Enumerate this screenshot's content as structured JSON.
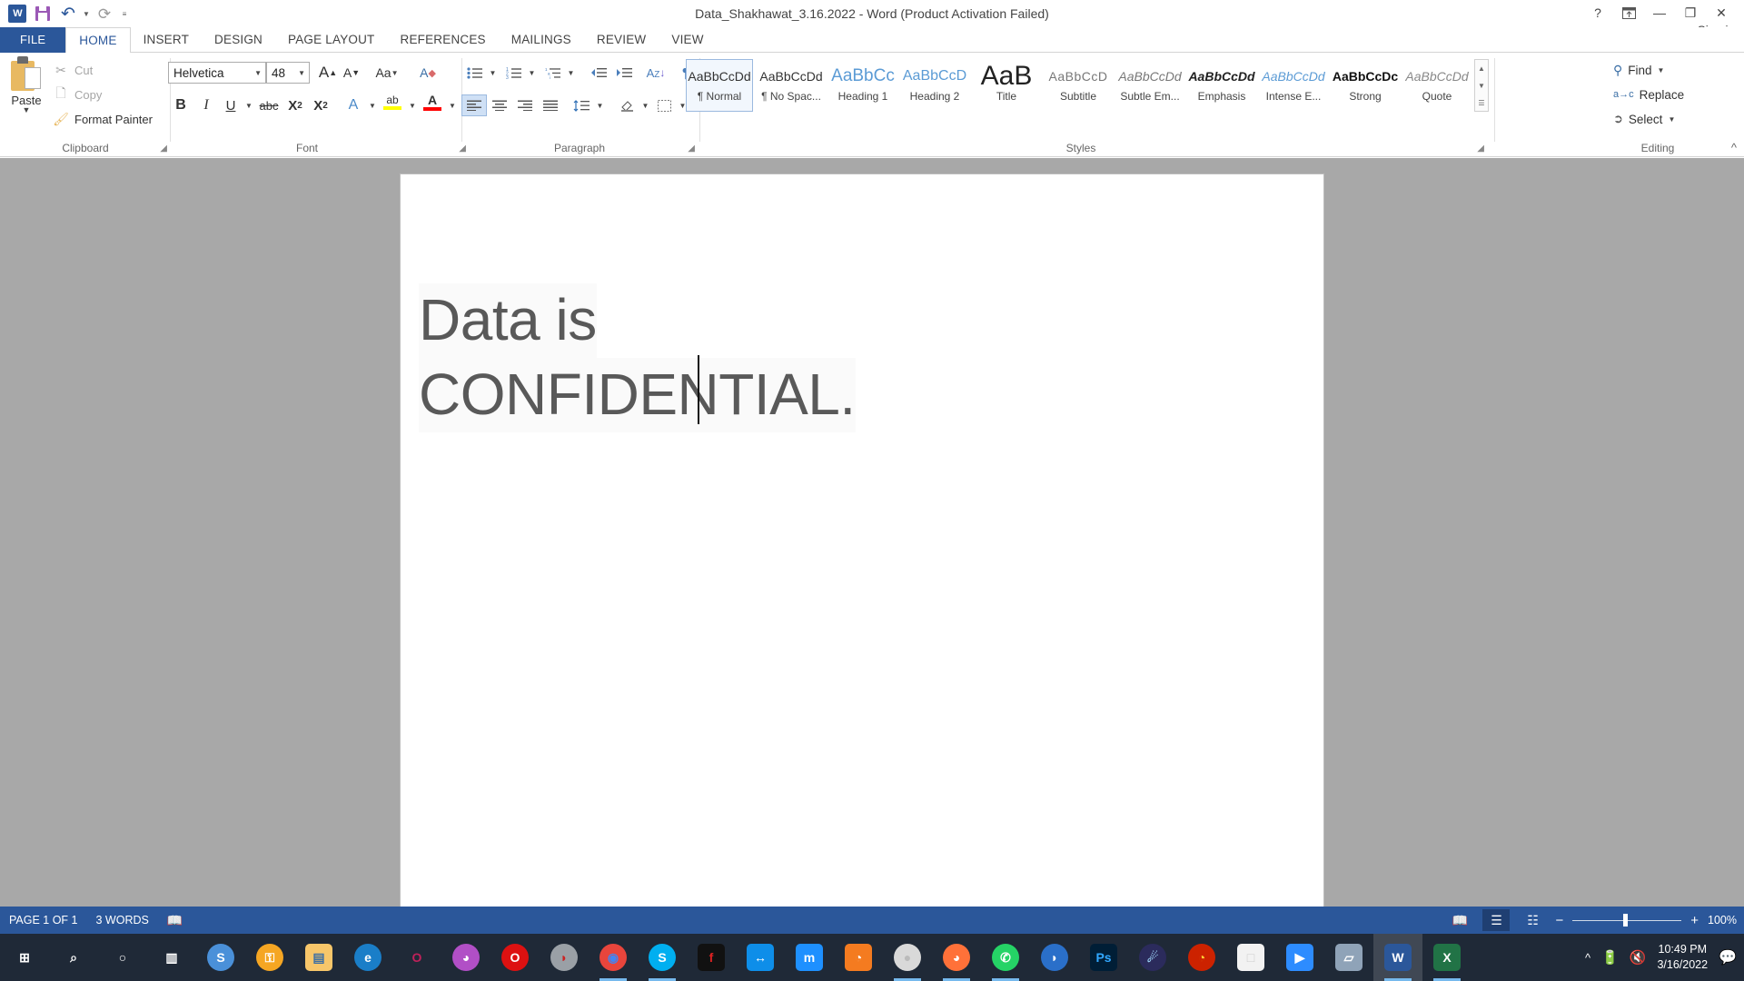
{
  "window": {
    "title": "Data_Shakhawat_3.16.2022 - Word (Product Activation Failed)",
    "signin": "Sign in",
    "help_icon": "?",
    "ribbon_display_icon": "ribbon-display-options-icon",
    "minimize_icon": "—",
    "restore_icon": "❐",
    "close_icon": "✕"
  },
  "quick_access": {
    "word_logo": "W",
    "save_label": "save-icon",
    "undo_label": "undo-icon",
    "redo_label": "redo-icon",
    "customize_label": "customize-quick-access-toolbar"
  },
  "tabs": [
    {
      "label": "FILE",
      "active": false,
      "file": true
    },
    {
      "label": "HOME",
      "active": true,
      "file": false
    },
    {
      "label": "INSERT",
      "active": false,
      "file": false
    },
    {
      "label": "DESIGN",
      "active": false,
      "file": false
    },
    {
      "label": "PAGE LAYOUT",
      "active": false,
      "file": false
    },
    {
      "label": "REFERENCES",
      "active": false,
      "file": false
    },
    {
      "label": "MAILINGS",
      "active": false,
      "file": false
    },
    {
      "label": "REVIEW",
      "active": false,
      "file": false
    },
    {
      "label": "VIEW",
      "active": false,
      "file": false
    }
  ],
  "clipboard": {
    "group_label": "Clipboard",
    "paste": "Paste",
    "cut": "Cut",
    "copy": "Copy",
    "format_painter": "Format Painter"
  },
  "font": {
    "group_label": "Font",
    "font_name": "Helvetica",
    "font_size": "48",
    "grow_font": "A",
    "shrink_font": "A",
    "change_case": "Aa",
    "clear_formatting": "A",
    "bold": "B",
    "italic": "I",
    "underline": "U",
    "strikethrough": "abc",
    "subscript": "X",
    "superscript": "X",
    "text_effects": "A",
    "highlight": "ab",
    "font_color": "A",
    "highlight_color": "#ffff00",
    "font_color_value": "#ff0000"
  },
  "paragraph": {
    "group_label": "Paragraph",
    "bullets": "bullets-icon",
    "numbering": "numbering-icon",
    "multilevel": "multilevel-list-icon",
    "decrease_indent": "◄≡",
    "increase_indent": "≡►",
    "sort": "sort-icon",
    "show_marks": "¶",
    "align_left": "align-left-icon",
    "align_center": "align-center-icon",
    "align_right": "align-right-icon",
    "justify": "justify-icon",
    "line_spacing": "line-spacing-icon",
    "shading": "shading-icon",
    "borders": "borders-icon"
  },
  "styles": {
    "group_label": "Styles",
    "items": [
      {
        "sample": "AaBbCcDd",
        "name": "¶ Normal",
        "selected": true,
        "style": "plain"
      },
      {
        "sample": "AaBbCcDd",
        "name": "¶ No Spac...",
        "selected": false,
        "style": "plain"
      },
      {
        "sample": "AaBbCc",
        "name": "Heading 1",
        "selected": false,
        "style": "heading1"
      },
      {
        "sample": "AaBbCcD",
        "name": "Heading 2",
        "selected": false,
        "style": "heading2"
      },
      {
        "sample": "AaB",
        "name": "Title",
        "selected": false,
        "style": "title"
      },
      {
        "sample": "AaBbCcD",
        "name": "Subtitle",
        "selected": false,
        "style": "subtitle"
      },
      {
        "sample": "AaBbCcDd",
        "name": "Subtle Em...",
        "selected": false,
        "style": "italic"
      },
      {
        "sample": "AaBbCcDd",
        "name": "Emphasis",
        "selected": false,
        "style": "bolditalic"
      },
      {
        "sample": "AaBbCcDd",
        "name": "Intense E...",
        "selected": false,
        "style": "blueitalic"
      },
      {
        "sample": "AaBbCcDc",
        "name": "Strong",
        "selected": false,
        "style": "bold"
      },
      {
        "sample": "AaBbCcDd",
        "name": "Quote",
        "selected": false,
        "style": "italicgray"
      }
    ],
    "scroll_up": "▲",
    "scroll_down": "▼",
    "scroll_more": "▤"
  },
  "editing": {
    "group_label": "Editing",
    "find": "Find",
    "replace": "Replace",
    "select": "Select",
    "collapse_ribbon": "^"
  },
  "document": {
    "line1": "Data is",
    "line2_before_caret": "CONFID",
    "line2_after_caret": "ENTIAL."
  },
  "status": {
    "page": "PAGE 1 OF 1",
    "words": "3 WORDS",
    "proofing_icon": "proofing-errors-icon",
    "read_mode_icon": "read-mode-icon",
    "print_layout_icon": "print-layout-icon",
    "web_layout_icon": "web-layout-icon",
    "zoom_out": "−",
    "zoom_in": "+",
    "zoom_level": "100%"
  },
  "taskbar": {
    "items": [
      {
        "name": "start-button",
        "glyph": "⊞",
        "bg": "transparent",
        "color": "#ffffff",
        "running": false,
        "active": false,
        "shape": "square"
      },
      {
        "name": "search-button",
        "glyph": "⌕",
        "bg": "transparent",
        "color": "#ffffff",
        "running": false,
        "active": false,
        "shape": "square"
      },
      {
        "name": "cortana-button",
        "glyph": "○",
        "bg": "transparent",
        "color": "#ffffff",
        "running": false,
        "active": false,
        "shape": "square"
      },
      {
        "name": "task-view-button",
        "glyph": "▥",
        "bg": "transparent",
        "color": "#ffffff",
        "running": false,
        "active": false,
        "shape": "square"
      },
      {
        "name": "internet-app-icon",
        "glyph": "S",
        "bg": "#4a90d9",
        "color": "#ffffff",
        "running": false,
        "active": false,
        "shape": "circle"
      },
      {
        "name": "avast-secure-browser-icon",
        "glyph": "⚿",
        "bg": "#f5a623",
        "color": "#ffffff",
        "running": false,
        "active": false,
        "shape": "circle"
      },
      {
        "name": "file-explorer-icon",
        "glyph": "▤",
        "bg": "#f7c66a",
        "color": "#3b6ea5",
        "running": false,
        "active": false,
        "shape": "square"
      },
      {
        "name": "microsoft-edge-icon",
        "glyph": "e",
        "bg": "#1a7ec8",
        "color": "#ffffff",
        "running": false,
        "active": false,
        "shape": "circle"
      },
      {
        "name": "opera-neon-icon",
        "glyph": "O",
        "bg": "transparent",
        "color": "#c0215a",
        "running": false,
        "active": false,
        "shape": "circle"
      },
      {
        "name": "opera-gx-icon",
        "glyph": "◕",
        "bg": "#b14fc6",
        "color": "#ffffff",
        "running": false,
        "active": false,
        "shape": "circle"
      },
      {
        "name": "opera-browser-icon",
        "glyph": "O",
        "bg": "#dd1111",
        "color": "#ffffff",
        "running": false,
        "active": false,
        "shape": "circle"
      },
      {
        "name": "avast-antivirus-icon",
        "glyph": "◗",
        "bg": "#9aa0a6",
        "color": "#cc2222",
        "running": false,
        "active": false,
        "shape": "circle"
      },
      {
        "name": "google-chrome-icon",
        "glyph": "◉",
        "bg": "#e8453c",
        "color": "#4285f4",
        "running": true,
        "active": false,
        "shape": "circle"
      },
      {
        "name": "skype-icon",
        "glyph": "S",
        "bg": "#00aff0",
        "color": "#ffffff",
        "running": true,
        "active": false,
        "shape": "circle"
      },
      {
        "name": "flash-player-icon",
        "glyph": "f",
        "bg": "#111111",
        "color": "#dd2222",
        "running": false,
        "active": false,
        "shape": "square"
      },
      {
        "name": "teamviewer-icon",
        "glyph": "↔",
        "bg": "#0e8ee9",
        "color": "#ffffff",
        "running": false,
        "active": false,
        "shape": "square"
      },
      {
        "name": "maxthon-icon",
        "glyph": "m",
        "bg": "#1e90ff",
        "color": "#ffffff",
        "running": false,
        "active": false,
        "shape": "square"
      },
      {
        "name": "uc-browser-icon",
        "glyph": "◔",
        "bg": "#f47b20",
        "color": "#ffffff",
        "running": false,
        "active": false,
        "shape": "square"
      },
      {
        "name": "sphere-app-icon",
        "glyph": "●",
        "bg": "#d9d9d9",
        "color": "#bbbbbb",
        "running": true,
        "active": false,
        "shape": "circle"
      },
      {
        "name": "mozilla-firefox-icon",
        "glyph": "◕",
        "bg": "#ff7139",
        "color": "#ffffff",
        "running": true,
        "active": false,
        "shape": "circle"
      },
      {
        "name": "whatsapp-icon",
        "glyph": "✆",
        "bg": "#25d366",
        "color": "#ffffff",
        "running": true,
        "active": false,
        "shape": "circle"
      },
      {
        "name": "blue-browser-icon",
        "glyph": "◗",
        "bg": "#2a6fc9",
        "color": "#ffffff",
        "running": false,
        "active": false,
        "shape": "circle"
      },
      {
        "name": "adobe-photoshop-icon",
        "glyph": "Ps",
        "bg": "#001e36",
        "color": "#31a8ff",
        "running": false,
        "active": false,
        "shape": "square"
      },
      {
        "name": "comet-app-icon",
        "glyph": "☄",
        "bg": "#2b2b5c",
        "color": "#9ad0f5",
        "running": false,
        "active": false,
        "shape": "circle"
      },
      {
        "name": "torch-browser-icon",
        "glyph": "◔",
        "bg": "#cc2200",
        "color": "#ffcc33",
        "running": false,
        "active": false,
        "shape": "circle"
      },
      {
        "name": "document-file-icon",
        "glyph": "□",
        "bg": "#f2f2f2",
        "color": "#cccccc",
        "running": false,
        "active": false,
        "shape": "square"
      },
      {
        "name": "zoom-icon",
        "glyph": "▶",
        "bg": "#2d8cff",
        "color": "#ffffff",
        "running": false,
        "active": false,
        "shape": "square"
      },
      {
        "name": "dev-tool-icon",
        "glyph": "▱",
        "bg": "#8fa3b8",
        "color": "#ffffff",
        "running": false,
        "active": false,
        "shape": "square"
      },
      {
        "name": "microsoft-word-icon",
        "glyph": "W",
        "bg": "#2b579a",
        "color": "#ffffff",
        "running": true,
        "active": true,
        "shape": "square"
      },
      {
        "name": "microsoft-excel-icon",
        "glyph": "X",
        "bg": "#217346",
        "color": "#ffffff",
        "running": true,
        "active": false,
        "shape": "square"
      }
    ],
    "tray": {
      "show_hidden_icons": "^",
      "battery_icon": "battery-charging-icon",
      "volume_icon": "volume-muted-icon",
      "time": "10:49 PM",
      "date": "3/16/2022",
      "action_center_icon": "action-center-icon"
    }
  }
}
